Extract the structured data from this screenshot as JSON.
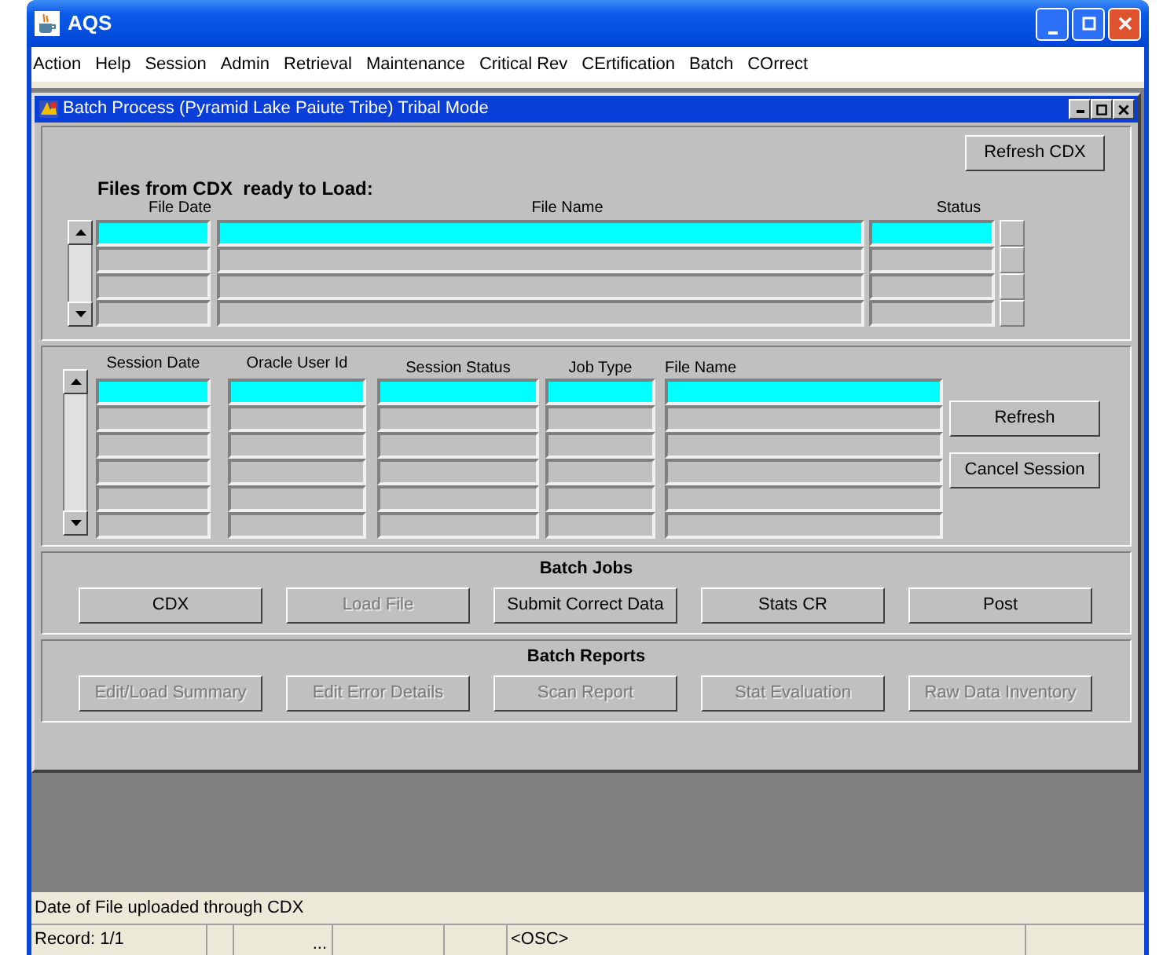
{
  "window": {
    "title": "AQS"
  },
  "menu": [
    "Action",
    "Help",
    "Session",
    "Admin",
    "Retrieval",
    "Maintenance",
    "Critical Rev",
    "CErtification",
    "Batch",
    "COrrect"
  ],
  "form": {
    "title": "Batch Process (Pyramid Lake Paiute Tribe) Tribal Mode",
    "refresh_cdx_button": {
      "label": "Refresh CDX",
      "disabled": false
    },
    "files_heading": "Files from CDX  ready to Load:",
    "files_table": {
      "columns": [
        "File Date",
        "File Name",
        "Status"
      ],
      "rows": [
        {
          "selected": true
        },
        {
          "selected": false
        },
        {
          "selected": false
        },
        {
          "selected": false
        }
      ]
    },
    "sessions_table": {
      "columns": [
        "Session Date",
        "Oracle User Id",
        "Session Status",
        "Job Type",
        "File Name"
      ],
      "rows": [
        {
          "selected": true
        },
        {
          "selected": false
        },
        {
          "selected": false
        },
        {
          "selected": false
        },
        {
          "selected": false
        },
        {
          "selected": false
        }
      ]
    },
    "session_buttons": [
      {
        "label": "Refresh",
        "disabled": false
      },
      {
        "label": "Cancel Session",
        "disabled": false
      }
    ],
    "batch_jobs": {
      "title": "Batch Jobs",
      "buttons": [
        {
          "label": "CDX",
          "disabled": false
        },
        {
          "label": "Load File",
          "disabled": true
        },
        {
          "label": "Submit Correct Data",
          "disabled": false
        },
        {
          "label": "Stats CR",
          "disabled": false
        },
        {
          "label": "Post",
          "disabled": false
        }
      ]
    },
    "batch_reports": {
      "title": "Batch Reports",
      "buttons": [
        {
          "label": "Edit/Load Summary",
          "disabled": true
        },
        {
          "label": "Edit Error Details",
          "disabled": true
        },
        {
          "label": "Scan Report",
          "disabled": true
        },
        {
          "label": "Stat Evaluation",
          "disabled": true
        },
        {
          "label": "Raw Data Inventory",
          "disabled": true
        }
      ]
    }
  },
  "status_bar": {
    "hint": "Date of File uploaded through CDX",
    "record": "Record: 1/1",
    "field_3": "...",
    "mode": "<OSC>"
  }
}
